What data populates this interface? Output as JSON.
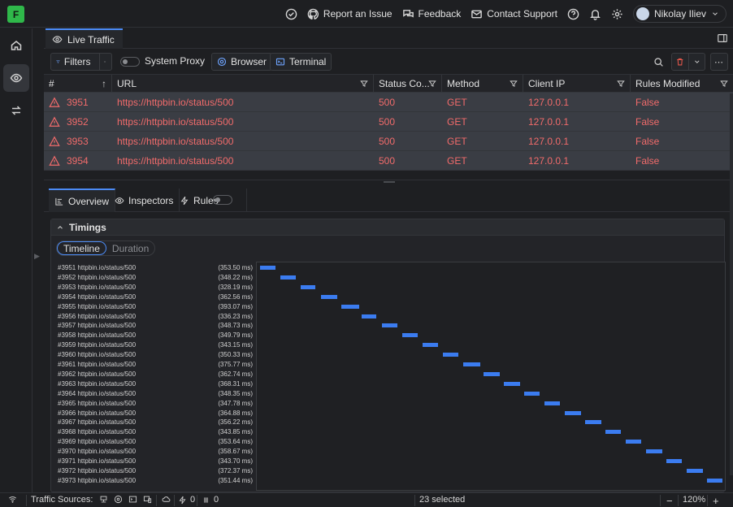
{
  "topbar": {
    "logo_letter": "F",
    "report_issue": "Report an Issue",
    "feedback": "Feedback",
    "contact_support": "Contact Support",
    "user_name": "Nikolay Iliev"
  },
  "main_tab": {
    "label": "Live Traffic"
  },
  "toolbar": {
    "filters_label": "Filters",
    "system_proxy_label": "System Proxy",
    "browser_label": "Browser",
    "terminal_label": "Terminal"
  },
  "grid": {
    "columns": [
      "#",
      "URL",
      "Status Co...",
      "Method",
      "Client IP",
      "Rules Modified"
    ],
    "rows": [
      {
        "id": "3951",
        "url": "https://httpbin.io/status/500",
        "status": "500",
        "method": "GET",
        "ip": "127.0.0.1",
        "rules": "False"
      },
      {
        "id": "3952",
        "url": "https://httpbin.io/status/500",
        "status": "500",
        "method": "GET",
        "ip": "127.0.0.1",
        "rules": "False"
      },
      {
        "id": "3953",
        "url": "https://httpbin.io/status/500",
        "status": "500",
        "method": "GET",
        "ip": "127.0.0.1",
        "rules": "False"
      },
      {
        "id": "3954",
        "url": "https://httpbin.io/status/500",
        "status": "500",
        "method": "GET",
        "ip": "127.0.0.1",
        "rules": "False"
      }
    ],
    "row_color": "#f16b6b",
    "row_bg": "#3a3d44"
  },
  "lower_tabs": {
    "overview": "Overview",
    "inspectors": "Inspectors",
    "rules": "Rules"
  },
  "timings": {
    "title": "Timings",
    "mode_timeline": "Timeline",
    "mode_duration": "Duration",
    "bar_color": "#3b7cf0",
    "entries": [
      {
        "label": "#3951 httpbin.io/status/500",
        "duration": "(353.50 ms)",
        "ms": 353.5
      },
      {
        "label": "#3952 httpbin.io/status/500",
        "duration": "(348.22 ms)",
        "ms": 348.22
      },
      {
        "label": "#3953 httpbin.io/status/500",
        "duration": "(328.19 ms)",
        "ms": 328.19
      },
      {
        "label": "#3954 httpbin.io/status/500",
        "duration": "(362.56 ms)",
        "ms": 362.56
      },
      {
        "label": "#3955 httpbin.io/status/500",
        "duration": "(393.07 ms)",
        "ms": 393.07
      },
      {
        "label": "#3956 httpbin.io/status/500",
        "duration": "(336.23 ms)",
        "ms": 336.23
      },
      {
        "label": "#3957 httpbin.io/status/500",
        "duration": "(348.73 ms)",
        "ms": 348.73
      },
      {
        "label": "#3958 httpbin.io/status/500",
        "duration": "(349.79 ms)",
        "ms": 349.79
      },
      {
        "label": "#3959 httpbin.io/status/500",
        "duration": "(343.15 ms)",
        "ms": 343.15
      },
      {
        "label": "#3960 httpbin.io/status/500",
        "duration": "(350.33 ms)",
        "ms": 350.33
      },
      {
        "label": "#3961 httpbin.io/status/500",
        "duration": "(375.77 ms)",
        "ms": 375.77
      },
      {
        "label": "#3962 httpbin.io/status/500",
        "duration": "(362.74 ms)",
        "ms": 362.74
      },
      {
        "label": "#3963 httpbin.io/status/500",
        "duration": "(368.31 ms)",
        "ms": 368.31
      },
      {
        "label": "#3964 httpbin.io/status/500",
        "duration": "(348.35 ms)",
        "ms": 348.35
      },
      {
        "label": "#3965 httpbin.io/status/500",
        "duration": "(347.78 ms)",
        "ms": 347.78
      },
      {
        "label": "#3966 httpbin.io/status/500",
        "duration": "(364.88 ms)",
        "ms": 364.88
      },
      {
        "label": "#3967 httpbin.io/status/500",
        "duration": "(356.22 ms)",
        "ms": 356.22
      },
      {
        "label": "#3968 httpbin.io/status/500",
        "duration": "(343.85 ms)",
        "ms": 343.85
      },
      {
        "label": "#3969 httpbin.io/status/500",
        "duration": "(353.64 ms)",
        "ms": 353.64
      },
      {
        "label": "#3970 httpbin.io/status/500",
        "duration": "(358.67 ms)",
        "ms": 358.67
      },
      {
        "label": "#3971 httpbin.io/status/500",
        "duration": "(343.70 ms)",
        "ms": 343.7
      },
      {
        "label": "#3972 httpbin.io/status/500",
        "duration": "(372.37 ms)",
        "ms": 372.37
      },
      {
        "label": "#3973 httpbin.io/status/500",
        "duration": "(351.44 ms)",
        "ms": 351.44
      }
    ]
  },
  "statusbar": {
    "traffic_sources": "Traffic Sources:",
    "warnings_count": "0",
    "paused_count": "0",
    "selected": "23 selected",
    "zoom": "120%"
  }
}
